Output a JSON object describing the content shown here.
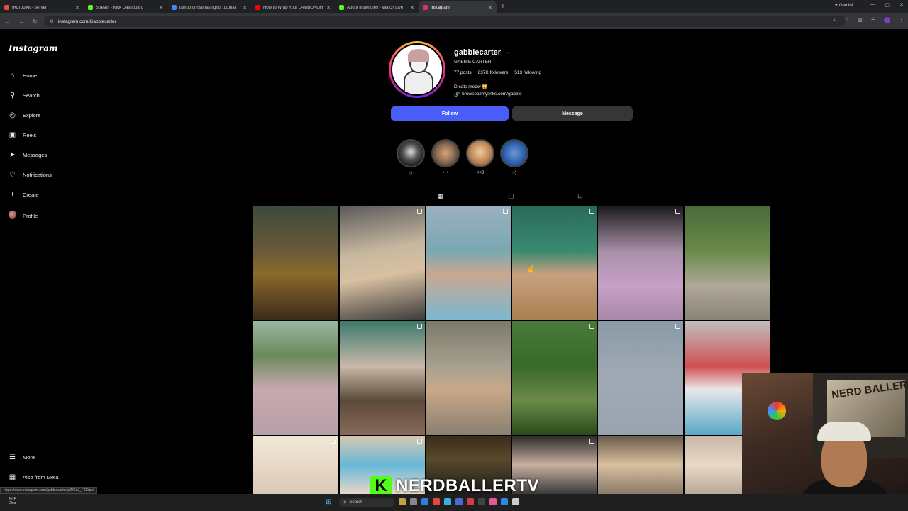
{
  "browser": {
    "tabs": [
      {
        "label": "IRLToolkit - Server",
        "icon_color": "#e74c3c"
      },
      {
        "label": "Stream - Kick Dashboard",
        "icon_color": "#53fc18"
      },
      {
        "label": "lambo christmas lights tutorial",
        "icon_color": "#4285f4"
      },
      {
        "label": "How to Wrap Your LAMBORGHI",
        "icon_color": "#ff0000"
      },
      {
        "label": "About imawful69 - Watch Live",
        "icon_color": "#53fc18"
      },
      {
        "label": "Instagram",
        "icon_color": "#e1306c"
      }
    ],
    "active_tab_index": 5,
    "new_tab": "+",
    "gemini_label": "Gemini",
    "url": "instagram.com/Gabbiecarter",
    "status_url": "https://www.instagram.com/gabbiecarter/p/DCn2_F6Efps/"
  },
  "sidebar": {
    "logo": "Instagram",
    "items": [
      {
        "label": "Home",
        "icon": "home-icon",
        "glyph": "⌂"
      },
      {
        "label": "Search",
        "icon": "search-icon",
        "glyph": "⚲"
      },
      {
        "label": "Explore",
        "icon": "compass-icon",
        "glyph": "◎"
      },
      {
        "label": "Reels",
        "icon": "reels-icon",
        "glyph": "▣"
      },
      {
        "label": "Messages",
        "icon": "messages-icon",
        "glyph": "➤"
      },
      {
        "label": "Notifications",
        "icon": "heart-icon",
        "glyph": "♡"
      },
      {
        "label": "Create",
        "icon": "plus-icon",
        "glyph": "+"
      },
      {
        "label": "Profile",
        "icon": "avatar-icon",
        "glyph": ""
      }
    ],
    "more": "More",
    "also_from_meta": "Also from Meta"
  },
  "profile": {
    "username": "gabbiecarter",
    "more_glyph": "⋯",
    "full_name": "GABBIE CARTER",
    "posts": "77 posts",
    "followers": "637K followers",
    "following": "513 following",
    "bio": "D cats meow 🙀",
    "link": "browseallmylinks.com/gabbie",
    "follow_label": "Follow",
    "message_label": "Message"
  },
  "highlights": [
    {
      "label": ";)",
      "bg": "radial-gradient(circle at 50% 45%, #ddd 0%, #555 40%, #111 80%)"
    },
    {
      "label": "•_•",
      "bg": "radial-gradient(circle at 50% 50%, #d6a77a 0%, #8a6a52 50%, #2a2a2a 90%)"
    },
    {
      "label": "<<3",
      "bg": "radial-gradient(circle at 50% 45%, #f0c89a 0%, #c08a5a 50%, #6a4a35 90%)"
    },
    {
      "label": ":-)",
      "bg": "radial-gradient(circle at 50% 50%, #6a9ad8 0%, #2a5aa8 60%, #1a2a58 95%)"
    }
  ],
  "profile_tabs": [
    {
      "name": "posts-grid-icon",
      "glyph": "▦"
    },
    {
      "name": "reels-tab-icon",
      "glyph": "▢"
    },
    {
      "name": "tagged-tab-icon",
      "glyph": "⊡"
    }
  ],
  "grid": [
    {
      "bg": "linear-gradient(180deg,#3a4a3a 0%,#6a5a3a 40%,#8a6a2a 60%,#3a2a1a 100%)",
      "multi": false
    },
    {
      "bg": "linear-gradient(170deg,#5a5a5a 0%,#c8b8a0 40%,#d8c0a0 60%,#3a3a3a 100%)",
      "multi": true
    },
    {
      "bg": "linear-gradient(180deg,#9ab0c0 0%,#7aa8b0 40%,#caa890 60%,#7ab8d0 100%)",
      "multi": true
    },
    {
      "bg": "linear-gradient(180deg,#2a6a5a 0%,#3a8a70 40%,#c8a080 60%,#a88050 100%)",
      "multi": true
    },
    {
      "bg": "linear-gradient(180deg,#1a1a1a 0%,#a890a8 40%,#c8a0c8 70%,#a888a8 100%)",
      "multi": true
    },
    {
      "bg": "linear-gradient(180deg,#4a6a3a 0%,#6a8a4a 40%,#b0a898 70%,#8a8478 100%)",
      "multi": false
    },
    {
      "bg": "linear-gradient(180deg,#9ab8a0 0%,#6a8a5a 30%,#c8a8b0 60%,#b8a0a8 100%)",
      "multi": false
    },
    {
      "bg": "linear-gradient(180deg,#3a7a6a 0%,#c8b8a8 40%,#5a4a3a 70%,#8a6a5a 100%)",
      "multi": true
    },
    {
      "bg": "linear-gradient(180deg,#7a7a6a 0%,#a8a090 40%,#c8a888 60%,#8a8070 100%)",
      "multi": false
    },
    {
      "bg": "linear-gradient(180deg,#4a7a3a 0%,#3a6a2a 40%,#6a8a4a 70%,#2a4a1a 100%)",
      "multi": true
    },
    {
      "bg": "linear-gradient(180deg,#8a9aa8 0%,#a0aab4 50%,#98a4b0 100%)",
      "multi": true
    },
    {
      "bg": "linear-gradient(180deg,#c0c0c0 0%,#d05050 40%,#e8e8e8 60%,#58a8c8 100%)",
      "multi": false
    },
    {
      "bg": "linear-gradient(180deg,#f0e8d8 0%,#e8d8c8 50%,#d8c8b8 100%)",
      "multi": true
    },
    {
      "bg": "linear-gradient(180deg,#d8c8b0 0%,#68b8d8 50%,#e8d8c8 100%)",
      "multi": true
    },
    {
      "bg": "linear-gradient(180deg,#3a2a1a 0%,#5a4a2a 40%,#1a1a1a 100%)",
      "multi": false
    },
    {
      "bg": "linear-gradient(180deg,#2a2a2a 0%,#c8b0a0 50%,#3a3a3a 100%)",
      "multi": true
    },
    {
      "bg": "linear-gradient(180deg,#6a5a4a 0%,#d8c0a0 50%,#8a7a6a 100%)",
      "multi": false
    },
    {
      "bg": "linear-gradient(180deg,#c8b8a8 0%,#e8d8c8 50%,#b8a898 100%)",
      "multi": false
    }
  ],
  "stream_overlay": {
    "watermark": "NERDBALLERTV",
    "logo_letter": "K",
    "art_text": "NERD BALLER"
  },
  "taskbar": {
    "weather_temp": "45°F",
    "weather_desc": "Clear",
    "search_placeholder": "Search"
  }
}
